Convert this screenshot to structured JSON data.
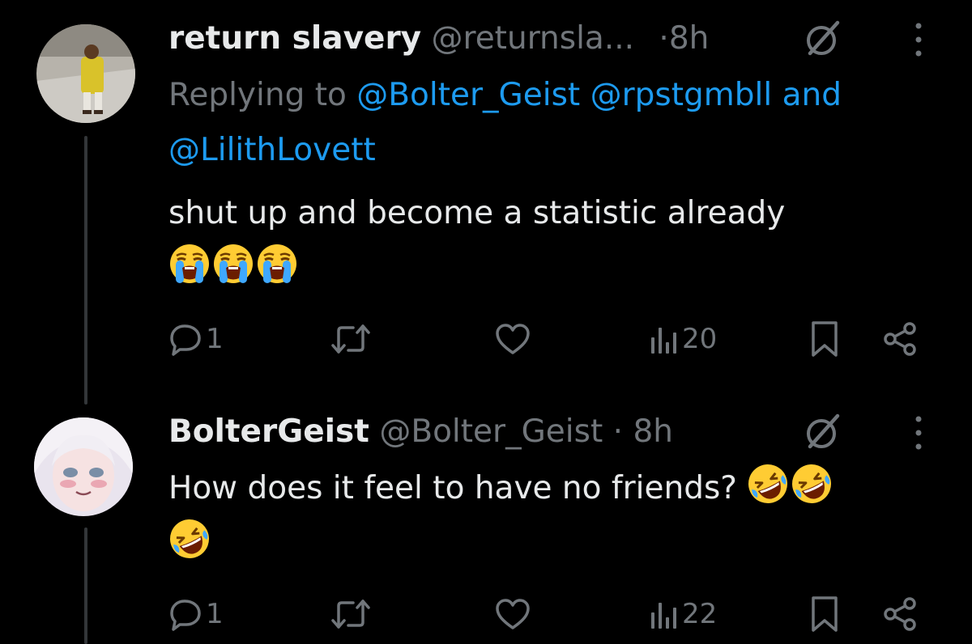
{
  "tweets": [
    {
      "display_name": "return slavery",
      "handle": "@returnsla...",
      "separator": "·",
      "time": "8h",
      "reply_prefix": "Replying to ",
      "mention_1": "@Bolter_Geist",
      "mention_2": "@rpstgmbll",
      "reply_and": "and",
      "mention_3": "@LilithLovett",
      "text": "shut up and become a statistic already",
      "emojis": [
        "loudly-crying-face",
        "loudly-crying-face",
        "loudly-crying-face"
      ],
      "actions": {
        "replies": "1",
        "reposts": "",
        "likes": "",
        "views": "20"
      }
    },
    {
      "display_name": "BolterGeist",
      "handle": "@Bolter_Geist",
      "separator": "·",
      "time": "8h",
      "text": "How does it feel to have no friends?",
      "emojis": [
        "rolling-on-floor-laughing",
        "rolling-on-floor-laughing",
        "rolling-on-floor-laughing"
      ],
      "actions": {
        "replies": "1",
        "reposts": "",
        "likes": "",
        "views": "22"
      }
    }
  ],
  "icons": [
    "grok-icon",
    "more-icon",
    "reply-icon",
    "repost-icon",
    "like-icon",
    "views-icon",
    "bookmark-icon",
    "share-icon"
  ],
  "colors": {
    "background": "#000000",
    "text": "#e7e9ea",
    "secondary": "#71767b",
    "link": "#1d9bf0",
    "thread_line": "#333639"
  }
}
